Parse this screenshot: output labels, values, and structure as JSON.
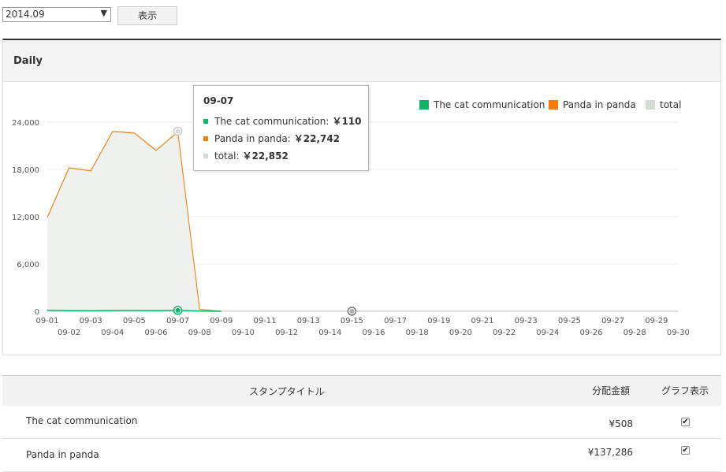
{
  "controls": {
    "month_select": "2014.09",
    "show_button": "表示"
  },
  "panel": {
    "title": "Daily"
  },
  "tooltip": {
    "date": "09-07",
    "rows": [
      {
        "label": "The cat communication:",
        "value": "￥110",
        "color": "#0fb367"
      },
      {
        "label": "Panda in panda:",
        "value": "￥22,742",
        "color": "#f57c00"
      },
      {
        "label": "total:",
        "value": "￥22,852",
        "color": "#d3dcd3"
      }
    ]
  },
  "chart_data": {
    "type": "area",
    "title": "",
    "xlabel": "",
    "ylabel": "",
    "ylim": [
      0,
      24000
    ],
    "yticks": [
      0,
      6000,
      12000,
      18000,
      24000
    ],
    "ytick_labels": [
      "0",
      "6,000",
      "12,000",
      "18,000",
      "24,000"
    ],
    "categories": [
      "09-01",
      "09-02",
      "09-03",
      "09-04",
      "09-05",
      "09-06",
      "09-07",
      "09-08",
      "09-09",
      "09-10",
      "09-11",
      "09-12",
      "09-13",
      "09-14",
      "09-15",
      "09-16",
      "09-17",
      "09-18",
      "09-19",
      "09-20",
      "09-21",
      "09-22",
      "09-23",
      "09-24",
      "09-25",
      "09-26",
      "09-27",
      "09-28",
      "09-29",
      "09-30"
    ],
    "series": [
      {
        "name": "The cat communication",
        "color": "#0fb367",
        "values": [
          120,
          80,
          60,
          90,
          100,
          80,
          110,
          30,
          0,
          null,
          null,
          null,
          null,
          null,
          null,
          null,
          null,
          null,
          null,
          null,
          null,
          null,
          null,
          null,
          null,
          null,
          null,
          null,
          null,
          null
        ]
      },
      {
        "name": "Panda in panda",
        "color": "#f57c00",
        "values": [
          11900,
          18200,
          17800,
          22800,
          22600,
          20400,
          22742,
          250,
          0,
          null,
          null,
          null,
          null,
          null,
          null,
          null,
          null,
          null,
          null,
          null,
          null,
          null,
          null,
          null,
          null,
          null,
          null,
          null,
          null,
          null
        ]
      },
      {
        "name": "total",
        "color": "#d3dcd3",
        "values": [
          12020,
          18280,
          17860,
          22890,
          22700,
          20480,
          22852,
          280,
          0,
          null,
          null,
          null,
          null,
          null,
          null,
          null,
          null,
          null,
          null,
          null,
          null,
          null,
          null,
          null,
          null,
          null,
          null,
          null,
          null,
          null
        ]
      }
    ],
    "legend_position": "top-right",
    "grid": true,
    "highlight_index": 6
  },
  "table": {
    "headers": {
      "title": "スタンプタイトル",
      "amount": "分配金額",
      "graph": "グラフ表示"
    },
    "rows": [
      {
        "title": "The cat communication",
        "amount": "¥508",
        "checked": true
      },
      {
        "title": "Panda in panda",
        "amount": "¥137,286",
        "checked": true
      }
    ]
  }
}
